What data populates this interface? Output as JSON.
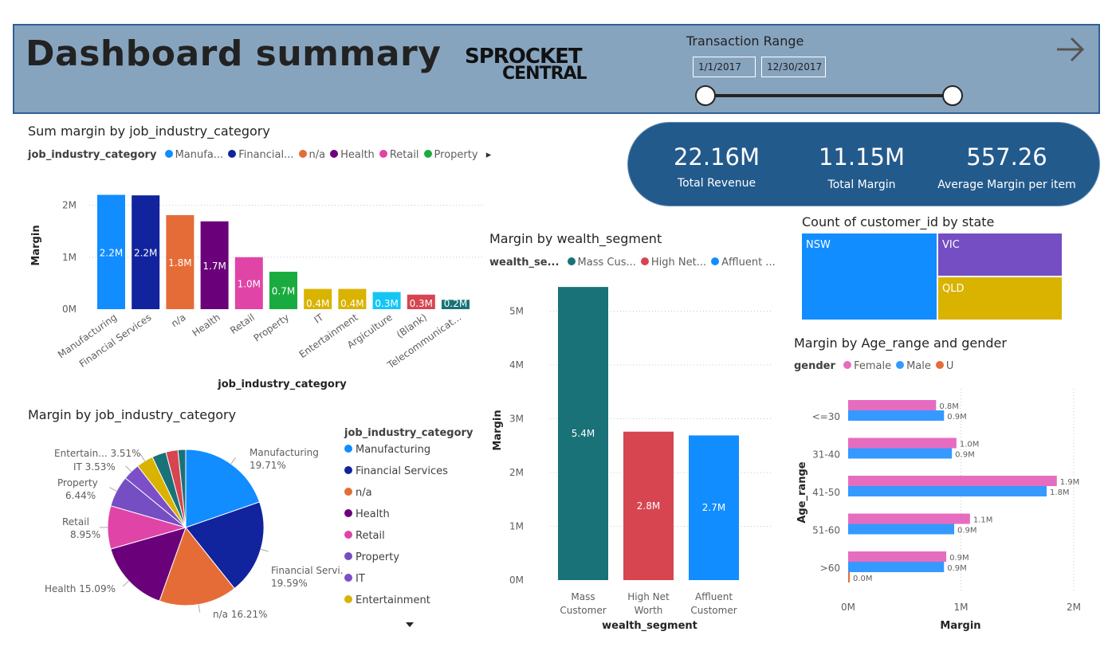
{
  "header": {
    "title": "Dashboard summary",
    "logo_line1": "SPROCKET",
    "logo_line2": "CENTRAL",
    "transaction_range_label": "Transaction Range",
    "date_start": "1/1/2017",
    "date_end": "12/30/2017",
    "slider_range": [
      0,
      1
    ]
  },
  "kpis": [
    {
      "value": "22.16M",
      "label": "Total Revenue"
    },
    {
      "value": "11.15M",
      "label": "Total Margin"
    },
    {
      "value": "557.26",
      "label": "Average Margin per item"
    }
  ],
  "colors": {
    "header_bg": "#87a4bf",
    "kpi_bg": "#235a8c",
    "manufacturing": "#118dff",
    "financial": "#12239e",
    "na": "#e66c37",
    "health": "#6b007b",
    "retail": "#e044a7",
    "property": "#1aab40",
    "it": "#d9b300",
    "entertainment": "#d9b300",
    "agriculture": "#15c6f4",
    "blank": "#d64550",
    "telecom": "#197278",
    "mass": "#197278",
    "high_net": "#d64550",
    "affluent": "#118dff",
    "nsw": "#118dff",
    "vic": "#744ec2",
    "qld": "#d9b300",
    "female": "#e66cc0",
    "male": "#3599ff",
    "u": "#e66c37"
  },
  "chart_data": [
    {
      "id": "bar_industry",
      "type": "bar",
      "title": "Sum margin by job_industry_category",
      "legend_title": "job_industry_category",
      "legend_items": [
        "Manufa...",
        "Financial...",
        "n/a",
        "Health",
        "Retail",
        "Property"
      ],
      "categories": [
        "Manufacturing",
        "Financial Services",
        "n/a",
        "Health",
        "Retail",
        "Property",
        "IT",
        "Entertainment",
        "Argiculture",
        "(Blank)",
        "Telecommunicat..."
      ],
      "values": [
        2.2,
        2.19,
        1.81,
        1.69,
        1.0,
        0.72,
        0.39,
        0.39,
        0.33,
        0.28,
        0.18
      ],
      "data_labels": [
        "2.2M",
        "2.2M",
        "1.8M",
        "1.7M",
        "1.0M",
        "0.7M",
        "0.4M",
        "0.4M",
        "0.3M",
        "0.3M",
        "0.2M"
      ],
      "xlabel": "job_industry_category",
      "ylabel": "Margin",
      "yticks": [
        "0M",
        "1M",
        "2M"
      ],
      "ylim": [
        0,
        2.3
      ],
      "grid": true
    },
    {
      "id": "pie_industry",
      "type": "pie",
      "title": "Margin by job_industry_category",
      "legend_title": "job_industry_category",
      "legend_items": [
        "Manufacturing",
        "Financial Services",
        "n/a",
        "Health",
        "Retail",
        "Property",
        "IT",
        "Entertainment"
      ],
      "slices": [
        {
          "name": "Manufacturing",
          "value": 19.71
        },
        {
          "name": "Financial Services",
          "value": 19.59
        },
        {
          "name": "n/a",
          "value": 16.21
        },
        {
          "name": "Health",
          "value": 15.09
        },
        {
          "name": "Retail",
          "value": 8.95
        },
        {
          "name": "Property",
          "value": 6.44
        },
        {
          "name": "IT",
          "value": 3.53
        },
        {
          "name": "Entertainment",
          "value": 3.51
        },
        {
          "name": "Argiculture",
          "value": 2.94
        },
        {
          "name": "(Blank)",
          "value": 2.5
        },
        {
          "name": "Telecommunications",
          "value": 1.6
        }
      ],
      "labels": [
        {
          "line1": "Manufacturing",
          "line2": "19.71%"
        },
        {
          "line1": "Financial Servi...",
          "line2": "19.59%"
        },
        {
          "line1": "n/a 16.21%",
          "line2": ""
        },
        {
          "line1": "Health 15.09%",
          "line2": ""
        },
        {
          "line1": "Retail",
          "line2": "8.95%"
        },
        {
          "line1": "Property",
          "line2": "6.44%"
        },
        {
          "line1": "IT 3.53%",
          "line2": ""
        },
        {
          "line1": "Entertain... 3.51%",
          "line2": ""
        }
      ]
    },
    {
      "id": "bar_wealth",
      "type": "bar",
      "title": "Margin by wealth_segment",
      "legend_title": "wealth_se...",
      "legend_items": [
        "Mass Cus...",
        "High Net...",
        "Affluent ..."
      ],
      "categories": [
        [
          "Mass",
          "Customer"
        ],
        [
          "High Net",
          "Worth"
        ],
        [
          "Affluent",
          "Customer"
        ]
      ],
      "values": [
        5.45,
        2.76,
        2.69
      ],
      "data_labels": [
        "5.4M",
        "2.8M",
        "2.7M"
      ],
      "xlabel": "wealth_segment",
      "ylabel": "Margin",
      "yticks": [
        "0M",
        "1M",
        "2M",
        "3M",
        "4M",
        "5M"
      ],
      "ylim": [
        0,
        5.5
      ],
      "grid": true
    },
    {
      "id": "treemap_state",
      "type": "heatmap",
      "title": "Count of customer_id by state",
      "items": [
        {
          "name": "NSW",
          "share": 0.52
        },
        {
          "name": "VIC",
          "share": 0.24
        },
        {
          "name": "QLD",
          "share": 0.24
        }
      ]
    },
    {
      "id": "bar_age_gender",
      "type": "bar",
      "title": "Margin by Age_range and gender",
      "legend_title": "gender",
      "legend_items": [
        "Female",
        "Male",
        "U"
      ],
      "categories": [
        "<=30",
        "31-40",
        "41-50",
        "51-60",
        ">60"
      ],
      "series": [
        {
          "name": "Female",
          "values": [
            0.78,
            0.96,
            1.85,
            1.08,
            0.87
          ],
          "labels": [
            "0.8M",
            "1.0M",
            "1.9M",
            "1.1M",
            "0.9M"
          ]
        },
        {
          "name": "Male",
          "values": [
            0.85,
            0.92,
            1.76,
            0.94,
            0.85
          ],
          "labels": [
            "0.9M",
            "0.9M",
            "1.8M",
            "0.9M",
            "0.9M"
          ]
        },
        {
          "name": "U",
          "values": [
            0,
            0,
            0,
            0,
            0.01
          ],
          "labels": [
            "",
            "",
            "",
            "",
            "0.0M"
          ]
        }
      ],
      "xlabel": "Margin",
      "ylabel": "Age_range",
      "xticks": [
        "0M",
        "1M",
        "2M"
      ],
      "xlim": [
        0,
        2
      ],
      "grid": true
    }
  ]
}
